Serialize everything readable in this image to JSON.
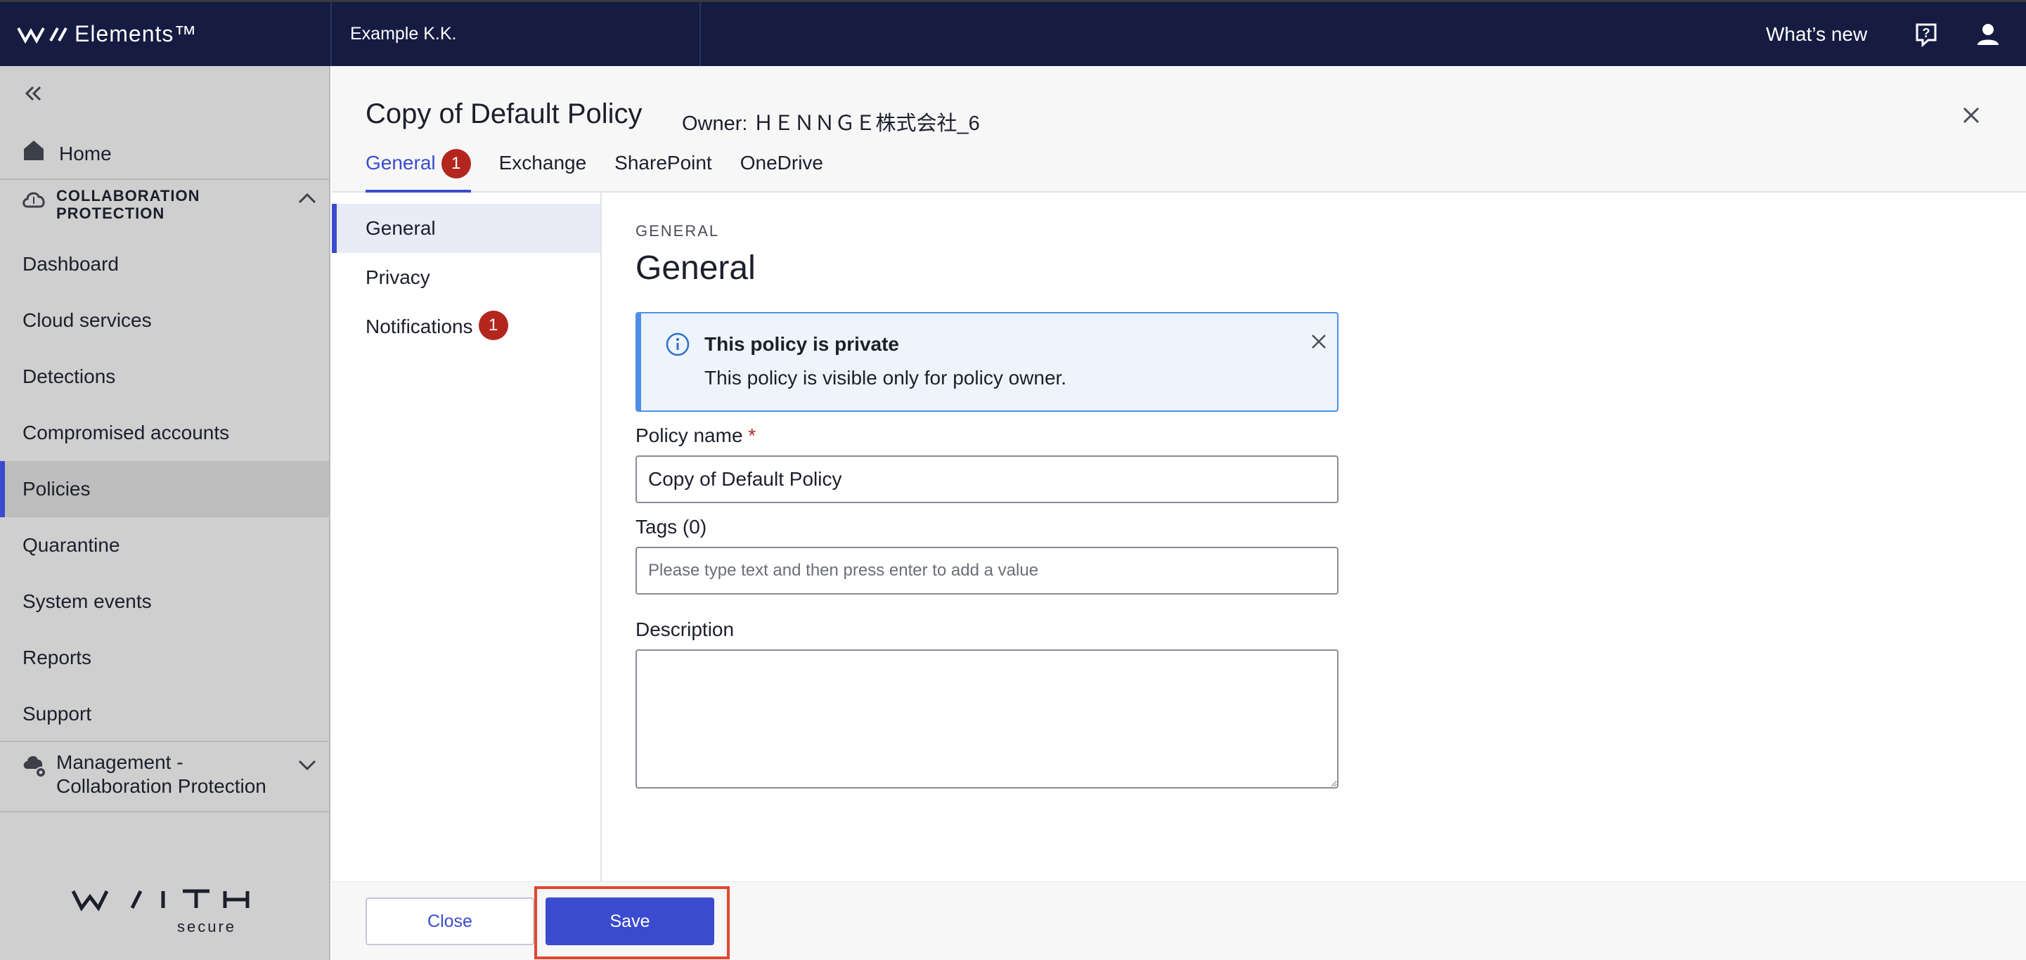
{
  "topbar": {
    "brand_name": "Elements™",
    "organization": "Example K.K.",
    "whats_new_label": "What’s new",
    "icons": [
      "brand-logo-icon",
      "help-icon",
      "user-account-icon"
    ],
    "background_color": "#151b41"
  },
  "sidebar": {
    "home_label": "Home",
    "section_label": "COLLABORATION PROTECTION",
    "items": [
      {
        "label": "Dashboard"
      },
      {
        "label": "Cloud services"
      },
      {
        "label": "Detections"
      },
      {
        "label": "Compromised accounts"
      },
      {
        "label": "Policies",
        "active": true
      },
      {
        "label": "Quarantine"
      },
      {
        "label": "System events"
      },
      {
        "label": "Reports"
      },
      {
        "label": "Support"
      }
    ],
    "management_label": "Management - Collaboration Protection",
    "footer_logo_text": "WITH",
    "footer_logo_sub": "secure"
  },
  "panel": {
    "title": "Copy of Default Policy",
    "owner": "Owner: ＨＥＮＮＧＥ株式会社_6",
    "tabs": [
      {
        "label": "General",
        "badge": "1",
        "active": true
      },
      {
        "label": "Exchange"
      },
      {
        "label": "SharePoint"
      },
      {
        "label": "OneDrive"
      }
    ]
  },
  "subnav": {
    "items": [
      {
        "label": "General",
        "active": true
      },
      {
        "label": "Privacy"
      },
      {
        "label": "Notifications",
        "badge": "1"
      }
    ]
  },
  "content": {
    "eyebrow": "GENERAL",
    "title": "General",
    "info": {
      "title": "This policy is private",
      "text": "This policy is visible only for policy owner."
    },
    "policy_name_label": "Policy name",
    "policy_name_required": "*",
    "policy_name_value": "Copy of Default Policy",
    "tags_label": "Tags (0)",
    "tags_placeholder": "Please type text and then press enter to add a value",
    "description_label": "Description",
    "description_value": ""
  },
  "footer": {
    "close_label": "Close",
    "save_label": "Save",
    "accent_color": "#3b4bcf",
    "highlight_color": "#e3462f"
  }
}
